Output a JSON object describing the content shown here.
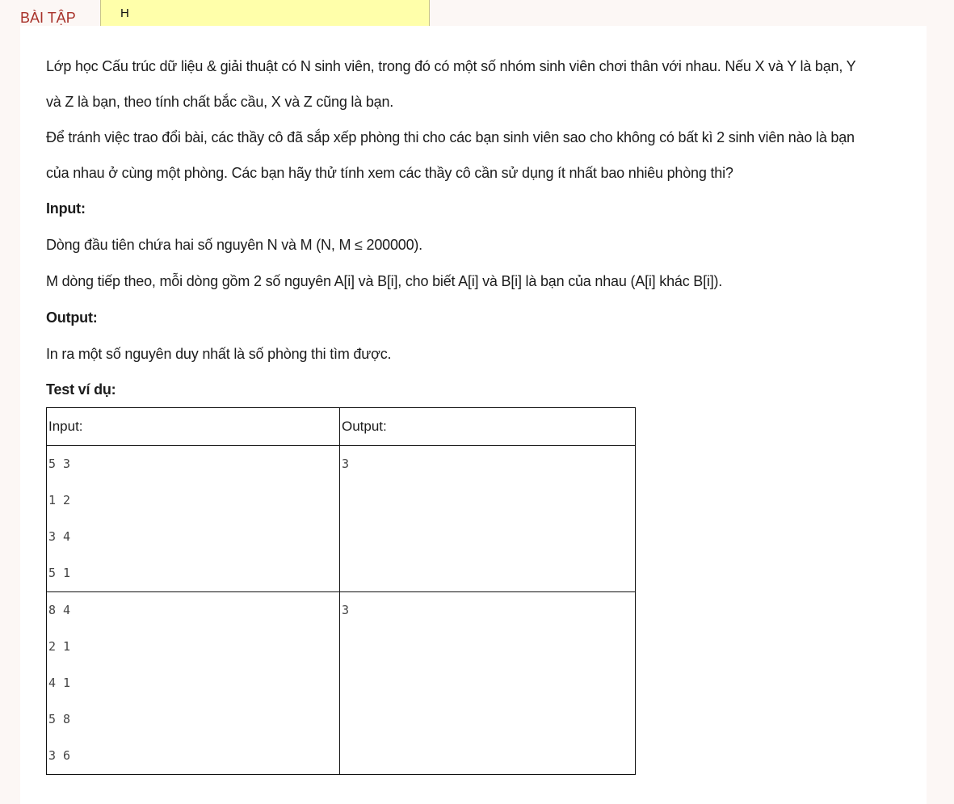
{
  "header": {
    "tab_label": "BÀI TẬP",
    "note_text": "H"
  },
  "problem": {
    "p1_line1": "Lớp học Cấu trúc dữ liệu & giải thuật có N sinh viên, trong đó có một số nhóm sinh viên chơi thân với nhau. Nếu X và Y là bạn, Y",
    "p1_line2": "và Z là bạn, theo tính chất bắc cầu, X và Z cũng là bạn.",
    "p2_line1": "Để tránh việc trao đổi bài, các thầy cô đã sắp xếp phòng thi cho các bạn sinh viên sao cho không có bất kì 2 sinh viên nào là bạn",
    "p2_line2": "của nhau ở cùng một phòng. Các bạn hãy thử tính xem các thầy cô cần sử dụng ít nhất bao nhiêu phòng thi?",
    "input_heading": "Input:",
    "input_line1": "Dòng đầu tiên chứa hai số nguyên N và M (N, M ≤ 200000).",
    "input_line2": "M dòng tiếp theo, mỗi dòng gồm 2 số nguyên A[i] và B[i], cho biết A[i] và B[i] là bạn của nhau (A[i] khác B[i]).",
    "output_heading": "Output:",
    "output_line1": "In ra một số nguyên duy nhất là số phòng thi tìm được.",
    "examples_heading": "Test ví dụ:"
  },
  "examples_table": {
    "headers": [
      "Input:",
      "Output:"
    ],
    "rows": [
      {
        "input": [
          "5 3",
          "1 2",
          "3 4",
          "5 1"
        ],
        "output": "3"
      },
      {
        "input": [
          "8 4",
          "2 1",
          "4 1",
          "5 8",
          "3 6"
        ],
        "output": "3"
      }
    ]
  }
}
